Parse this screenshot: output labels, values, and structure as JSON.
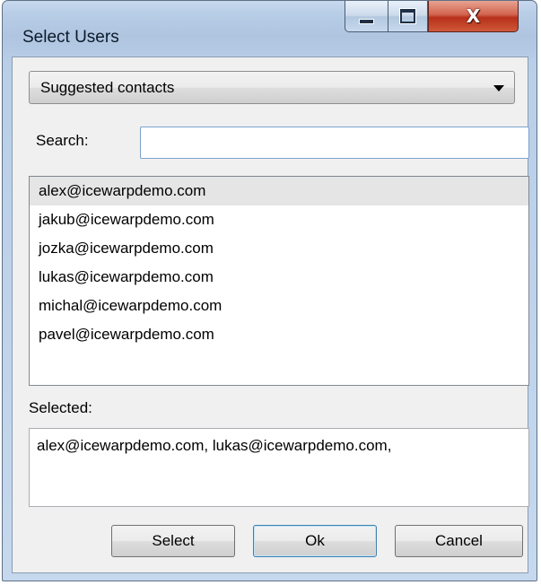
{
  "window": {
    "title": "Select Users",
    "controls": {
      "minimize": "minimize-icon",
      "maximize": "maximize-icon",
      "close": "close-icon",
      "close_glyph": "X"
    }
  },
  "source_combo": {
    "value": "Suggested contacts",
    "icon": "chevron-down-icon"
  },
  "search": {
    "label": "Search:",
    "value": "",
    "placeholder": ""
  },
  "users": {
    "items": [
      "alex@icewarpdemo.com",
      "jakub@icewarpdemo.com",
      "jozka@icewarpdemo.com",
      "lukas@icewarpdemo.com",
      "michal@icewarpdemo.com",
      "pavel@icewarpdemo.com"
    ],
    "highlighted": "alex@icewarpdemo.com"
  },
  "selected": {
    "label": "Selected:",
    "value": "alex@icewarpdemo.com, lukas@icewarpdemo.com,"
  },
  "buttons": {
    "select": "Select",
    "ok": "Ok",
    "cancel": "Cancel"
  },
  "colors": {
    "titlebar": "#b9cfe8",
    "close_button": "#c7432a",
    "dialog_background": "#f0f0f0",
    "list_highlight": "#e5e5e5"
  }
}
